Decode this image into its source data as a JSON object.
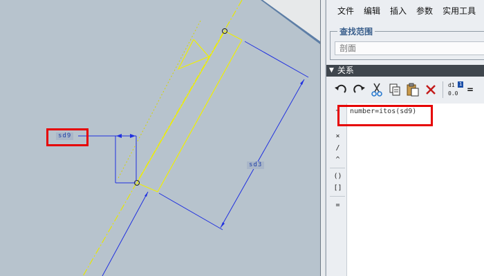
{
  "viewport": {
    "dimension_labels": {
      "sd9": "sd9",
      "sd3": "sd3"
    }
  },
  "menubar": {
    "items": [
      "文件",
      "编辑",
      "插入",
      "参数",
      "实用工具"
    ]
  },
  "search": {
    "label": "查找范围",
    "placeholder": "剖面"
  },
  "relations": {
    "title": "关系",
    "toolbar": {
      "icons": [
        "undo-icon",
        "redo-icon",
        "cut-icon",
        "copy-icon",
        "paste-icon",
        "delete-icon",
        "show-dimension-values-icon"
      ],
      "toggle_top": "d1",
      "toggle_badge": "1",
      "toggle_bottom": "0.0",
      "equals": "="
    },
    "side_tools": [
      "+",
      "×",
      "/",
      "^",
      "()",
      "[]",
      "="
    ],
    "editor_text": "number=itos(sd9)"
  },
  "colors": {
    "annotation_highlight": "#e60000",
    "dimension": "#1f2fe0",
    "geometry": "#f0f000"
  }
}
